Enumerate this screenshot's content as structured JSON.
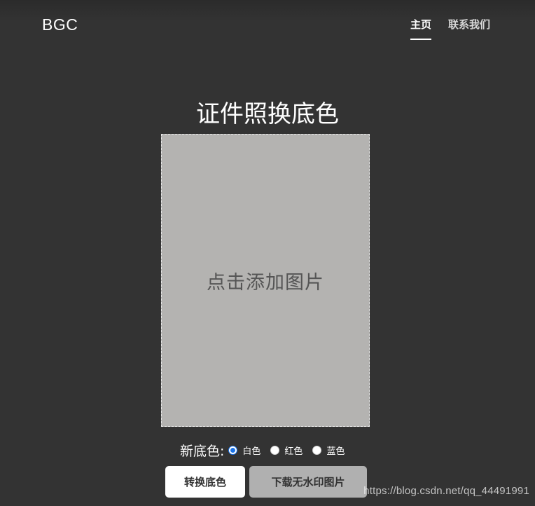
{
  "header": {
    "brand": "BGC",
    "nav": [
      {
        "label": "主页",
        "active": true
      },
      {
        "label": "联系我们",
        "active": false
      }
    ]
  },
  "main": {
    "title": "证件照换底色",
    "upload_placeholder": "点击添加图片",
    "color_label": "新底色:",
    "options": [
      {
        "label": "白色",
        "selected": true
      },
      {
        "label": "红色",
        "selected": false
      },
      {
        "label": "蓝色",
        "selected": false
      }
    ],
    "convert_button": "转换底色",
    "download_button": "下载无水印图片"
  },
  "watermark": "https://blog.csdn.net/qq_44491991",
  "colors": {
    "background": "#333333",
    "upload_area": "#b4b3b1",
    "radio_accent": "#1a73e8",
    "download_button": "#b0b0b0"
  }
}
